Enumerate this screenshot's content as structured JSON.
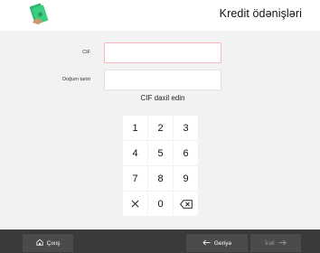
{
  "header": {
    "title": "Kredit ödənişləri",
    "logo_icon": "money-banknote-icon"
  },
  "form": {
    "cif_label": "CIF",
    "cif_value": "",
    "dob_label": "Doğum tarixi",
    "dob_value": "",
    "hint": "CIF daxil edin"
  },
  "keypad": {
    "keys": [
      "1",
      "2",
      "3",
      "4",
      "5",
      "6",
      "7",
      "8",
      "9",
      "×",
      "0",
      "⌫"
    ],
    "clear_icon": "close-icon",
    "backspace_icon": "backspace-icon"
  },
  "footer": {
    "exit_label": "Çıxış",
    "exit_icon": "home-icon",
    "back_label": "Geriyə",
    "back_icon": "arrow-left-icon",
    "next_label": "İrəli",
    "next_icon": "arrow-right-icon"
  },
  "colors": {
    "header_bg": "#ffffff",
    "page_bg": "#f2f2f2",
    "footer_bg": "#3a3a3a",
    "button_bg": "#4b4b4b",
    "active_field_border": "#f2b8bb",
    "logo_green": "#2eb872"
  }
}
